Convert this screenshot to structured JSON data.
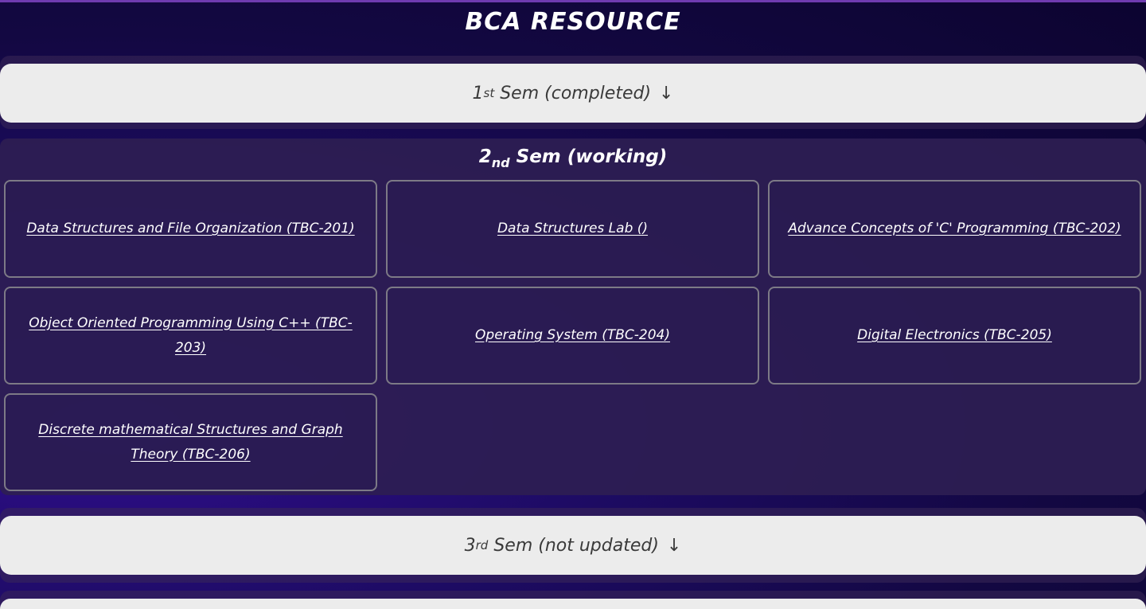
{
  "header": {
    "title": "BCA RESOURCE"
  },
  "semesters": [
    {
      "ordinal": "1",
      "suffix": "st",
      "label": "Sem (completed)",
      "arrow": "↓"
    },
    {
      "ordinal": "2",
      "suffix": "nd",
      "label": "Sem (working)",
      "subjects": [
        "Data Structures and File Organization (TBC-201)",
        "Data Structures Lab ()",
        "Advance Concepts of 'C' Programming (TBC-202)",
        "Object Oriented Programming Using C++ (TBC-203)",
        "Operating System (TBC-204)",
        "Digital Electronics (TBC-205)",
        "Discrete mathematical Structures and Graph Theory (TBC-206)"
      ]
    },
    {
      "ordinal": "3",
      "suffix": "rd",
      "label": "Sem (not updated)",
      "arrow": "↓"
    }
  ],
  "colors": {
    "background": "#130842",
    "toggle_bg": "#ececec",
    "toggle_text": "#3a3a3a",
    "card_border": "#7d7a86",
    "accent_line": "#6f3bb0"
  }
}
